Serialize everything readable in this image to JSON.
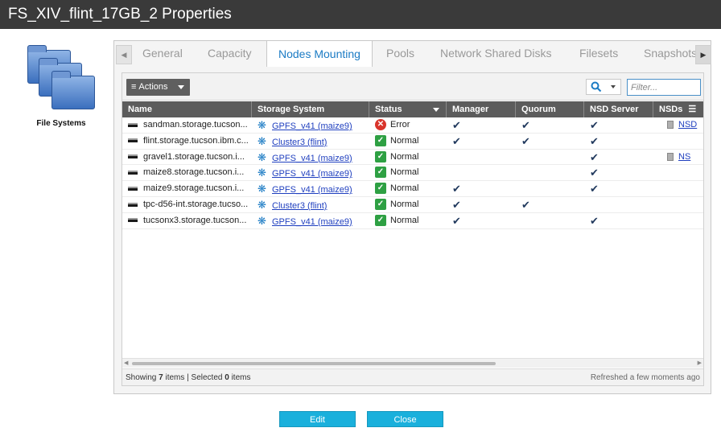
{
  "window": {
    "title": "FS_XIV_flint_17GB_2 Properties"
  },
  "left_panel": {
    "label": "File Systems",
    "icon": "folders-icon"
  },
  "tabs": [
    {
      "label": "General",
      "active": false
    },
    {
      "label": "Capacity",
      "active": false
    },
    {
      "label": "Nodes Mounting",
      "active": true
    },
    {
      "label": "Pools",
      "active": false
    },
    {
      "label": "Network Shared Disks",
      "active": false
    },
    {
      "label": "Filesets",
      "active": false
    },
    {
      "label": "Snapshots",
      "active": false
    }
  ],
  "toolbar": {
    "actions_label": "Actions",
    "filter_placeholder": "Filter..."
  },
  "table": {
    "columns": [
      "Name",
      "Storage System",
      "Status",
      "Manager",
      "Quorum",
      "NSD Server",
      "NSDs"
    ],
    "rows": [
      {
        "name": "sandman.storage.tucson...",
        "storage": "GPFS_v41 (maize9)",
        "status": "Error",
        "manager": true,
        "quorum": true,
        "nsd_server": true,
        "nsds": "NSD"
      },
      {
        "name": "flint.storage.tucson.ibm.c...",
        "storage": "Cluster3 (flint)",
        "status": "Normal",
        "manager": true,
        "quorum": true,
        "nsd_server": true,
        "nsds": ""
      },
      {
        "name": "gravel1.storage.tucson.i...",
        "storage": "GPFS_v41 (maize9)",
        "status": "Normal",
        "manager": false,
        "quorum": false,
        "nsd_server": true,
        "nsds": "NS"
      },
      {
        "name": "maize8.storage.tucson.i...",
        "storage": "GPFS_v41 (maize9)",
        "status": "Normal",
        "manager": false,
        "quorum": false,
        "nsd_server": true,
        "nsds": ""
      },
      {
        "name": "maize9.storage.tucson.i...",
        "storage": "GPFS_v41 (maize9)",
        "status": "Normal",
        "manager": true,
        "quorum": false,
        "nsd_server": true,
        "nsds": ""
      },
      {
        "name": "tpc-d56-int.storage.tucso...",
        "storage": "Cluster3 (flint)",
        "status": "Normal",
        "manager": true,
        "quorum": true,
        "nsd_server": false,
        "nsds": ""
      },
      {
        "name": "tucsonx3.storage.tucson...",
        "storage": "GPFS_v41 (maize9)",
        "status": "Normal",
        "manager": true,
        "quorum": false,
        "nsd_server": true,
        "nsds": ""
      }
    ]
  },
  "footer": {
    "showing_prefix": "Showing ",
    "showing_count": "7",
    "showing_mid": " items | Selected ",
    "selected_count": "0",
    "showing_suffix": " items",
    "refreshed": "Refreshed a few moments ago"
  },
  "buttons": {
    "edit": "Edit",
    "close": "Close"
  },
  "colors": {
    "accent": "#1b7bc4",
    "button": "#1ab0dc",
    "ok": "#2ea043",
    "error": "#d9342b",
    "header": "#5c5c5c"
  }
}
